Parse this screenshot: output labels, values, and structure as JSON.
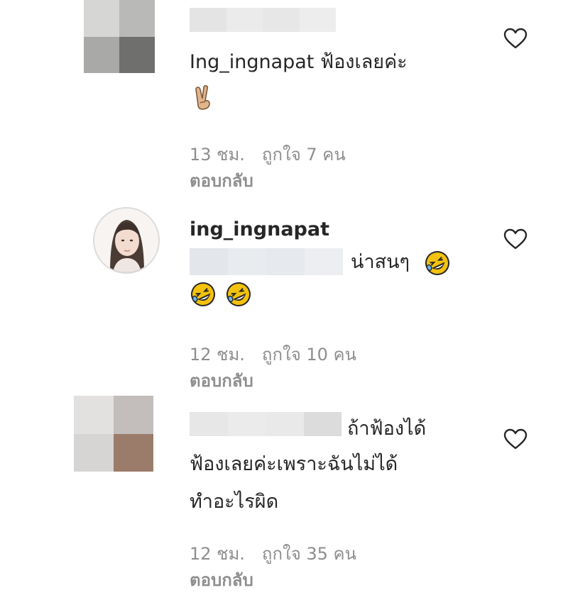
{
  "icons": {
    "like": "heart-outline-icon",
    "victory_emoji": "victory-hand-emoji",
    "laugh_emoji": "rolling-on-floor-laughing-emoji"
  },
  "colors": {
    "text": "#262626",
    "meta": "#8e8e8e",
    "heart_stroke": "#262626",
    "emoji_yellow": "#f4c20d"
  },
  "comments": [
    {
      "username": "",
      "text_lines": [
        "Ing_ingnapat ฟ้องเลยค่ะ"
      ],
      "time": "13 ชม.",
      "likes": "ถูกใจ 7 คน",
      "reply": "ตอบกลับ"
    },
    {
      "username": "ing_ingnapat",
      "text_lines": [
        "น่าสนๆ"
      ],
      "time": "12 ชม.",
      "likes": "ถูกใจ 10 คน",
      "reply": "ตอบกลับ"
    },
    {
      "username": "",
      "text_lines": [
        "ถ้าฟ้องได้",
        "ฟ้องเลยค่ะเพราะฉันไม่ได้",
        "ทำอะไรผิด"
      ],
      "time": "12 ชม.",
      "likes": "ถูกใจ 35 คน",
      "reply": "ตอบกลับ"
    }
  ]
}
